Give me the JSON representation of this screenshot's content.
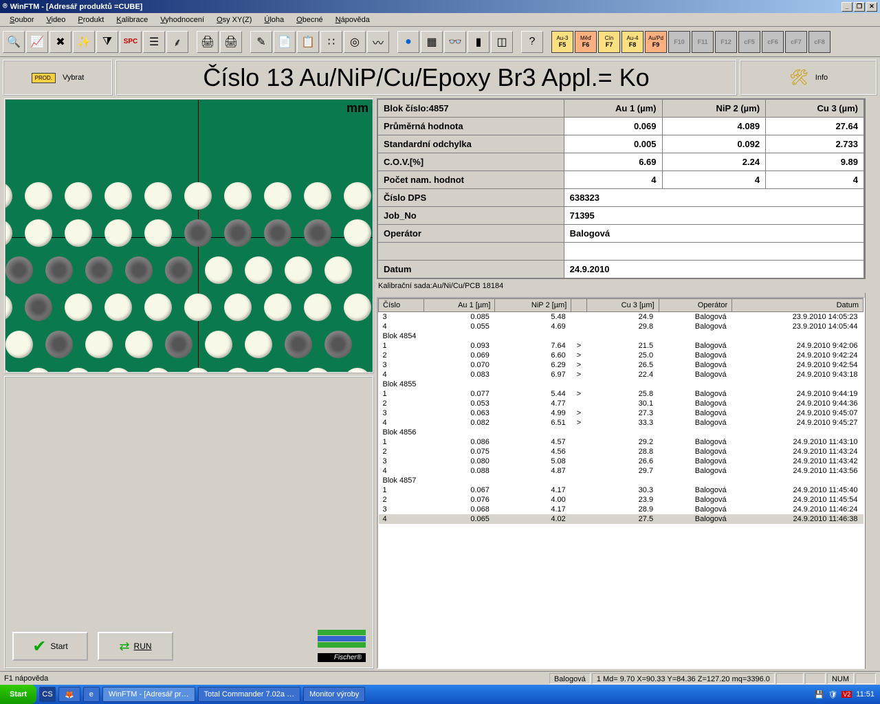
{
  "title": "WinFTM - [Adresář produktů =CUBE]",
  "menu": [
    "Soubor",
    "Video",
    "Produkt",
    "Kalibrace",
    "Vyhodnocení",
    "Osy XY(Z)",
    "Úloha",
    "Obecné",
    "Nápověda"
  ],
  "fkeys": [
    {
      "t": "Au-3",
      "k": "F5",
      "c": "#ffe080"
    },
    {
      "t": "Měď",
      "k": "F6",
      "c": "#ffb080"
    },
    {
      "t": "Cín",
      "k": "F7",
      "c": "#ffe080"
    },
    {
      "t": "Au-4",
      "k": "F8",
      "c": "#ffe080"
    },
    {
      "t": "Au/Pd",
      "k": "F9",
      "c": "#ffb080"
    },
    {
      "t": "",
      "k": "F10",
      "c": ""
    },
    {
      "t": "",
      "k": "F11",
      "c": ""
    },
    {
      "t": "",
      "k": "F12",
      "c": ""
    },
    {
      "t": "",
      "k": "cF5",
      "c": ""
    },
    {
      "t": "",
      "k": "cF6",
      "c": ""
    },
    {
      "t": "",
      "k": "cF7",
      "c": ""
    },
    {
      "t": "",
      "k": "cF8",
      "c": ""
    }
  ],
  "header": {
    "select_label": "Vybrat",
    "main_label": "Číslo 13   Au/NiP/Cu/Epoxy Br3   Appl.= Ko",
    "info_label": "Info"
  },
  "camera": {
    "unit": "mm"
  },
  "stats": {
    "block_label": "Blok číslo:4857",
    "cols": [
      "Au 1 (µm)",
      "NiP 2 (µm)",
      "Cu 3 (µm)"
    ],
    "rows": [
      {
        "l": "Průměrná hodnota",
        "v": [
          "0.069",
          "4.089",
          "27.64"
        ]
      },
      {
        "l": "Standardní odchylka",
        "v": [
          "0.005",
          "0.092",
          "2.733"
        ]
      },
      {
        "l": "C.O.V.[%]",
        "v": [
          "6.69",
          "2.24",
          "9.89"
        ]
      },
      {
        "l": "Počet nam. hodnot",
        "v": [
          "4",
          "4",
          "4"
        ]
      }
    ],
    "meta": [
      {
        "l": "Číslo DPS",
        "v": "638323"
      },
      {
        "l": "Job_No",
        "v": "71395"
      },
      {
        "l": "Operátor",
        "v": "Balogová"
      },
      {
        "l": "",
        "v": ""
      },
      {
        "l": "Datum",
        "v": "24.9.2010"
      }
    ]
  },
  "calib": "Kalibrační sada:Au/Ni/Cu/PCB 18184",
  "grid": {
    "cols": [
      "Číslo",
      "Au 1 [µm]",
      "NiP 2 [µm]",
      "",
      "Cu 3 [µm]",
      "Operátor",
      "Datum"
    ],
    "rows": [
      {
        "c": [
          "3",
          "0.085",
          "5.48",
          "",
          "24.9",
          "Balogová",
          "23.9.2010 14:05:23"
        ]
      },
      {
        "c": [
          "4",
          "0.055",
          "4.69",
          "",
          "29.8",
          "Balogová",
          "23.9.2010 14:05:44"
        ]
      },
      {
        "blok": "Blok 4854"
      },
      {
        "c": [
          "1",
          "0.093",
          "7.64",
          ">",
          "21.5",
          "Balogová",
          "24.9.2010 9:42:06"
        ]
      },
      {
        "c": [
          "2",
          "0.069",
          "6.60",
          ">",
          "25.0",
          "Balogová",
          "24.9.2010 9:42:24"
        ]
      },
      {
        "c": [
          "3",
          "0.070",
          "6.29",
          ">",
          "26.5",
          "Balogová",
          "24.9.2010 9:42:54"
        ]
      },
      {
        "c": [
          "4",
          "0.083",
          "6.97",
          ">",
          "22.4",
          "Balogová",
          "24.9.2010 9:43:18"
        ]
      },
      {
        "blok": "Blok 4855"
      },
      {
        "c": [
          "1",
          "0.077",
          "5.44",
          ">",
          "25.8",
          "Balogová",
          "24.9.2010 9:44:19"
        ]
      },
      {
        "c": [
          "2",
          "0.053",
          "4.77",
          "",
          "30.1",
          "Balogová",
          "24.9.2010 9:44:36"
        ]
      },
      {
        "c": [
          "3",
          "0.063",
          "4.99",
          ">",
          "27.3",
          "Balogová",
          "24.9.2010 9:45:07"
        ]
      },
      {
        "c": [
          "4",
          "0.082",
          "6.51",
          ">",
          "33.3",
          "Balogová",
          "24.9.2010 9:45:27"
        ]
      },
      {
        "blok": "Blok 4856"
      },
      {
        "c": [
          "1",
          "0.086",
          "4.57",
          "",
          "29.2",
          "Balogová",
          "24.9.2010 11:43:10"
        ]
      },
      {
        "c": [
          "2",
          "0.075",
          "4.56",
          "",
          "28.8",
          "Balogová",
          "24.9.2010 11:43:24"
        ]
      },
      {
        "c": [
          "3",
          "0.080",
          "5.08",
          "",
          "26.6",
          "Balogová",
          "24.9.2010 11:43:42"
        ]
      },
      {
        "c": [
          "4",
          "0.088",
          "4.87",
          "",
          "29.7",
          "Balogová",
          "24.9.2010 11:43:56"
        ]
      },
      {
        "blok": "Blok 4857"
      },
      {
        "c": [
          "1",
          "0.067",
          "4.17",
          "",
          "30.3",
          "Balogová",
          "24.9.2010 11:45:40"
        ]
      },
      {
        "c": [
          "2",
          "0.076",
          "4.00",
          "",
          "23.9",
          "Balogová",
          "24.9.2010 11:45:54"
        ]
      },
      {
        "c": [
          "3",
          "0.068",
          "4.17",
          "",
          "28.9",
          "Balogová",
          "24.9.2010 11:46:24"
        ]
      },
      {
        "c": [
          "4",
          "0.065",
          "4.02",
          "",
          "27.5",
          "Balogová",
          "24.9.2010 11:46:38"
        ],
        "sel": true
      }
    ]
  },
  "buttons": {
    "start": "Start",
    "run": "RUN"
  },
  "fischer": "Fischer®",
  "status": {
    "help": "F1 nápověda",
    "op": "Balogová",
    "md": "1  Md= 9.70  X=90.33  Y=84.36   Z=127.20 mq=3396.0",
    "num": "NUM"
  },
  "taskbar": {
    "start": "Start",
    "items": [
      "WinFTM - [Adresář pr…",
      "Total Commander 7.02a …",
      "Monitor výroby"
    ],
    "lang": "CS",
    "time": "11:51"
  }
}
